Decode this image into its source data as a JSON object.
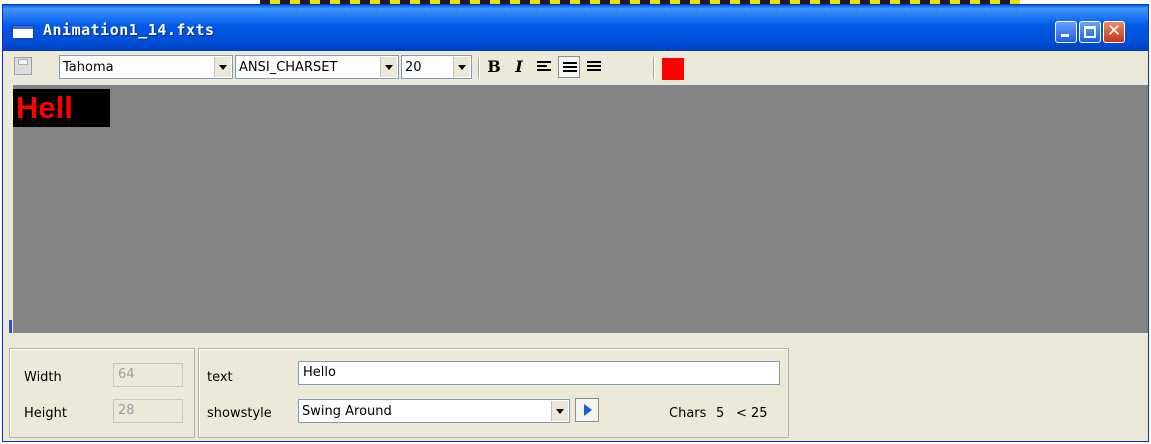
{
  "window": {
    "title": "Animation1_14.fxts",
    "close_glyph": "✕"
  },
  "toolbar": {
    "font_family": "Tahoma",
    "charset": "ANSI_CHARSET",
    "font_size": "20",
    "bold_label": "B",
    "italic_label": "I",
    "text_color": "#ff0000"
  },
  "preview": {
    "text": "Hell",
    "text_color": "#ff0000",
    "background": "#000000"
  },
  "canvas": {
    "background": "#848484"
  },
  "size_panel": {
    "width_label": "Width",
    "width_value": "64",
    "height_label": "Height",
    "height_value": "28"
  },
  "text_panel": {
    "text_label": "text",
    "text_value": "Hello",
    "showstyle_label": "showstyle",
    "showstyle_value": "Swing Around",
    "chars_label": "Chars",
    "chars_count": "5",
    "chars_limit": "< 25"
  },
  "icons": [
    "window-icon",
    "minimize-icon",
    "maximize-icon",
    "close-icon",
    "save-icon",
    "align-left-icon",
    "align-center-icon",
    "align-right-icon",
    "play-icon"
  ]
}
